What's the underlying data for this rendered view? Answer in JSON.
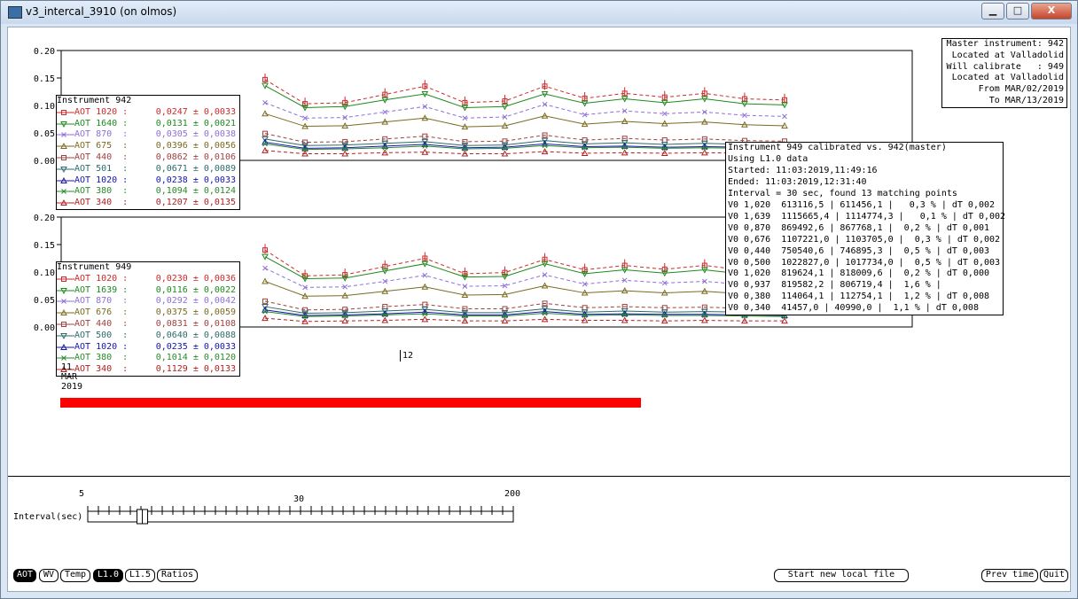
{
  "window": {
    "title": "v3_intercal_3910 (on olmos)",
    "controls": [
      "▁",
      "□",
      "X"
    ]
  },
  "colors": {
    "red": "#cc2a2a",
    "green": "#1d8a1d",
    "violet": "#8e6fd8",
    "olive": "#7a6a20",
    "brown": "#a04040",
    "teal": "#2c6b6b",
    "blue": "#1515b0",
    "green2": "#2a8a2a",
    "red2": "#b02020",
    "bar": "#ff0000"
  },
  "master_box": {
    "lines": [
      "Master instrument: 942",
      "Located at Valladolid",
      "Will calibrate   : 949",
      "Located at Valladolid",
      "From MAR/02/2019",
      "To MAR/13/2019"
    ]
  },
  "plot_top": {
    "y_ticks": [
      "0.20",
      "0.15",
      "0.10",
      "0.05",
      "0.00"
    ],
    "legend_title": "Instrument 942",
    "legend": [
      {
        "label": "AOT 1020 :",
        "value": "0,0247 ± 0,0033",
        "color": "#cc2a2a",
        "marker": "square"
      },
      {
        "label": "AOT 1640 :",
        "value": "0,0131 ± 0,0021",
        "color": "#1d8a1d",
        "marker": "tri-down"
      },
      {
        "label": "AOT 870  :",
        "value": "0,0305 ± 0,0038",
        "color": "#8e6fd8",
        "marker": "x"
      },
      {
        "label": "AOT 675  :",
        "value": "0,0396 ± 0,0056",
        "color": "#7a6a20",
        "marker": "tri-up"
      },
      {
        "label": "AOT 440  :",
        "value": "0,0862 ± 0,0106",
        "color": "#a04040",
        "marker": "square"
      },
      {
        "label": "AOT 501  :",
        "value": "0,0671 ± 0,0089",
        "color": "#2c6b6b",
        "marker": "tri-down"
      },
      {
        "label": "AOT 1020 :",
        "value": "0,0238 ± 0,0033",
        "color": "#1515b0",
        "marker": "tri-up"
      },
      {
        "label": "AOT 380  :",
        "value": "0,1094 ± 0,0124",
        "color": "#2a8a2a",
        "marker": "x"
      },
      {
        "label": "AOT 340  :",
        "value": "0,1207 ± 0,0135",
        "color": "#b02020",
        "marker": "tri-up"
      }
    ]
  },
  "plot_bottom": {
    "y_ticks": [
      "0.20",
      "0.15",
      "0.10",
      "0.05",
      "0.00"
    ],
    "legend_title": "Instrument 949",
    "legend": [
      {
        "label": "AOT 1020 :",
        "value": "0,0230 ± 0,0036",
        "color": "#cc2a2a",
        "marker": "square"
      },
      {
        "label": "AOT 1639 :",
        "value": "0,0116 ± 0,0022",
        "color": "#1d8a1d",
        "marker": "tri-down"
      },
      {
        "label": "AOT 870  :",
        "value": "0,0292 ± 0,0042",
        "color": "#8e6fd8",
        "marker": "x"
      },
      {
        "label": "AOT 676  :",
        "value": "0,0375 ± 0,0059",
        "color": "#7a6a20",
        "marker": "tri-up"
      },
      {
        "label": "AOT 440  :",
        "value": "0,0831 ± 0,0108",
        "color": "#a04040",
        "marker": "square"
      },
      {
        "label": "AOT 500  :",
        "value": "0,0640 ± 0,0088",
        "color": "#2c6b6b",
        "marker": "tri-down"
      },
      {
        "label": "AOT 1020 :",
        "value": "0,0235 ± 0,0033",
        "color": "#1515b0",
        "marker": "tri-up"
      },
      {
        "label": "AOT 380  :",
        "value": "0,1014 ± 0,0120",
        "color": "#2a8a2a",
        "marker": "x"
      },
      {
        "label": "AOT 340  :",
        "value": "0,1129 ± 0,0133",
        "color": "#b02020",
        "marker": "tri-up"
      }
    ],
    "x_tick_label": "12",
    "date_lines": [
      "11",
      "MAR",
      "2019"
    ]
  },
  "chart_data": [
    {
      "type": "line",
      "title": "",
      "xlabel": "",
      "ylabel": "",
      "ylim": [
        0,
        0.2
      ],
      "y_ticks": [
        0.0,
        0.05,
        0.1,
        0.15,
        0.2
      ],
      "series_names": [
        "AOT 1020",
        "AOT 1640",
        "AOT 870",
        "AOT 675",
        "AOT 440",
        "AOT 501",
        "AOT 1020",
        "AOT 380",
        "AOT 340"
      ],
      "series": [
        {
          "values": [
            0.147,
            0.103,
            0.105,
            0.12,
            0.135,
            0.105,
            0.108,
            0.135,
            0.113,
            0.122,
            0.115,
            0.122,
            0.112,
            0.11
          ]
        },
        {
          "values": [
            0.136,
            0.096,
            0.098,
            0.11,
            0.121,
            0.096,
            0.098,
            0.121,
            0.104,
            0.112,
            0.105,
            0.112,
            0.103,
            0.101
          ]
        },
        {
          "values": [
            0.105,
            0.077,
            0.078,
            0.088,
            0.098,
            0.077,
            0.079,
            0.102,
            0.083,
            0.09,
            0.085,
            0.088,
            0.082,
            0.08
          ]
        },
        {
          "values": [
            0.085,
            0.062,
            0.063,
            0.07,
            0.077,
            0.061,
            0.063,
            0.081,
            0.066,
            0.071,
            0.067,
            0.07,
            0.065,
            0.063
          ]
        },
        {
          "values": [
            0.049,
            0.033,
            0.034,
            0.039,
            0.044,
            0.034,
            0.035,
            0.046,
            0.037,
            0.04,
            0.037,
            0.039,
            0.036,
            0.035
          ]
        },
        {
          "values": [
            0.039,
            0.027,
            0.028,
            0.031,
            0.034,
            0.027,
            0.028,
            0.036,
            0.03,
            0.032,
            0.029,
            0.031,
            0.029,
            0.028
          ]
        },
        {
          "values": [
            0.033,
            0.022,
            0.023,
            0.026,
            0.029,
            0.023,
            0.024,
            0.03,
            0.025,
            0.026,
            0.024,
            0.025,
            0.024,
            0.023
          ]
        },
        {
          "values": [
            0.03,
            0.02,
            0.021,
            0.023,
            0.026,
            0.021,
            0.022,
            0.027,
            0.023,
            0.024,
            0.022,
            0.023,
            0.022,
            0.021
          ]
        },
        {
          "values": [
            0.018,
            0.012,
            0.012,
            0.014,
            0.015,
            0.012,
            0.012,
            0.016,
            0.013,
            0.014,
            0.013,
            0.014,
            0.013,
            0.012
          ]
        }
      ]
    },
    {
      "type": "line",
      "title": "",
      "xlabel": "",
      "ylabel": "",
      "ylim": [
        0,
        0.2
      ],
      "y_ticks": [
        0.0,
        0.05,
        0.1,
        0.15,
        0.2
      ],
      "series_names": [
        "AOT 1020",
        "AOT 1639",
        "AOT 870",
        "AOT 676",
        "AOT 440",
        "AOT 500",
        "AOT 1020",
        "AOT 380",
        "AOT 340"
      ],
      "series": [
        {
          "values": [
            0.14,
            0.093,
            0.095,
            0.11,
            0.125,
            0.097,
            0.099,
            0.123,
            0.104,
            0.112,
            0.105,
            0.112,
            0.103,
            0.101
          ]
        },
        {
          "values": [
            0.128,
            0.088,
            0.089,
            0.102,
            0.115,
            0.091,
            0.092,
            0.115,
            0.097,
            0.104,
            0.098,
            0.104,
            0.096,
            0.094
          ]
        },
        {
          "values": [
            0.107,
            0.072,
            0.073,
            0.083,
            0.094,
            0.074,
            0.075,
            0.095,
            0.078,
            0.085,
            0.08,
            0.083,
            0.077,
            0.075
          ]
        },
        {
          "values": [
            0.083,
            0.056,
            0.057,
            0.065,
            0.073,
            0.058,
            0.059,
            0.075,
            0.062,
            0.066,
            0.062,
            0.065,
            0.06,
            0.058
          ]
        },
        {
          "values": [
            0.047,
            0.031,
            0.032,
            0.037,
            0.041,
            0.033,
            0.033,
            0.043,
            0.035,
            0.037,
            0.035,
            0.036,
            0.034,
            0.033
          ]
        },
        {
          "values": [
            0.037,
            0.025,
            0.026,
            0.029,
            0.032,
            0.026,
            0.026,
            0.033,
            0.027,
            0.029,
            0.027,
            0.028,
            0.027,
            0.026
          ]
        },
        {
          "values": [
            0.031,
            0.021,
            0.022,
            0.024,
            0.027,
            0.022,
            0.022,
            0.028,
            0.023,
            0.024,
            0.023,
            0.023,
            0.022,
            0.021
          ]
        },
        {
          "values": [
            0.028,
            0.019,
            0.02,
            0.022,
            0.024,
            0.02,
            0.02,
            0.025,
            0.021,
            0.022,
            0.021,
            0.021,
            0.02,
            0.019
          ]
        },
        {
          "values": [
            0.016,
            0.01,
            0.011,
            0.012,
            0.014,
            0.011,
            0.011,
            0.014,
            0.012,
            0.012,
            0.011,
            0.012,
            0.011,
            0.011
          ]
        }
      ]
    }
  ],
  "calib_box": {
    "lines": [
      "Instrument 949 calibrated vs. 942(master)",
      "Using L1.0 data",
      "Started: 11:03:2019,11:49:16",
      "Ended: 11:03:2019,12:31:40",
      "Interval = 30 sec, found 13 matching points",
      "V0 1,020  613116,5 | 611456,1 |   0,3 % | dT 0,002",
      "V0 1,639  1115665,4 | 1114774,3 |   0,1 % | dT 0,002",
      "V0 0,870  869492,6 | 867768,1 |  0,2 % | dT 0,001",
      "V0 0,676  1107221,0 | 1103705,0 |  0,3 % | dT 0,002",
      "V0 0,440  750540,6 | 746895,3 |  0,5 % | dT 0,003",
      "V0 0,500  1022827,0 | 1017734,0 |  0,5 % | dT 0,003",
      "V0 1,020  819624,1 | 818009,6 |  0,2 % | dT 0,000",
      "V0 0,937  819582,2 | 806719,4 |  1,6 % |",
      "V0 0,380  114064,1 | 112754,1 |  1,2 % | dT 0,008",
      "V0 0,340  41457,0 | 40990,0 |  1,1 % | dT 0,008"
    ]
  },
  "progress": {
    "fraction": 1.0
  },
  "interval": {
    "label": "Interval(sec)",
    "min_label": "5",
    "mid_label": "30",
    "max_label": "200",
    "value": 30
  },
  "buttons": {
    "aot": "AOT",
    "wv": "WV",
    "temp": "Temp",
    "l10": "L1.0",
    "l15": "L1.5",
    "ratios": "Ratios",
    "start_file": "Start new local file",
    "prev_time": "Prev time",
    "quit": "Quit"
  }
}
